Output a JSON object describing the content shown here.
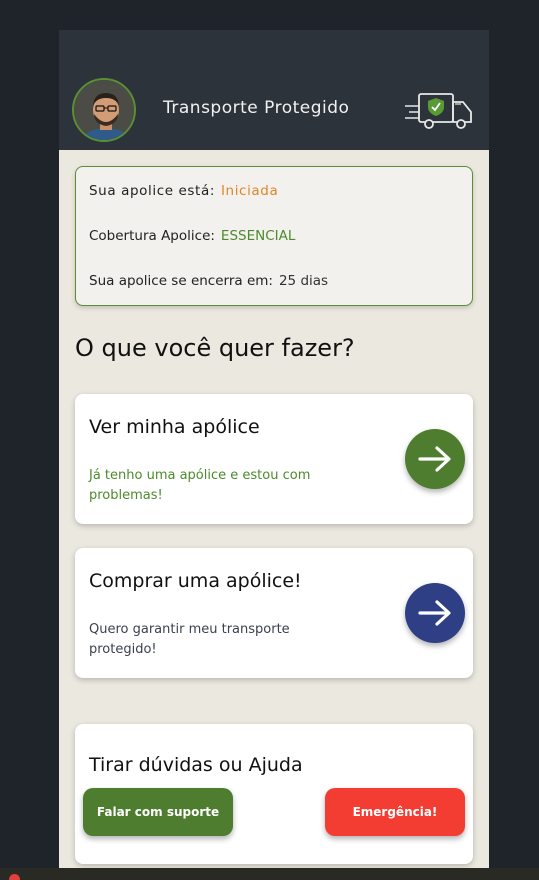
{
  "header": {
    "title": "Transporte Protegido",
    "avatar_icon": "user-avatar",
    "truck_icon": "truck-shield-icon"
  },
  "status": {
    "row1_label": "Sua apolice está:",
    "row1_value": "Iniciada",
    "row2_label": "Cobertura Apolice:",
    "row2_value": "ESSENCIAL",
    "row3_label": "Sua apolice se encerra em:",
    "row3_value": "25 dias"
  },
  "main": {
    "question": "O que você quer fazer?"
  },
  "cards": {
    "view": {
      "title": "Ver minha apólice",
      "description": "Já tenho uma apólice e estou com problemas!"
    },
    "buy": {
      "title": "Comprar uma apólice!",
      "description": "Quero garantir meu transporte protegido!"
    },
    "help": {
      "title": "Tirar dúvidas ou Ajuda",
      "support_label": "Falar com suporte",
      "emergency_label": "Emergência!"
    }
  },
  "colors": {
    "green": "#4e7d2f",
    "blue": "#2f3f86",
    "red": "#f33c32",
    "orange": "#e0862a",
    "header_bg": "#2d333a",
    "page_bg": "#ebe8df"
  }
}
